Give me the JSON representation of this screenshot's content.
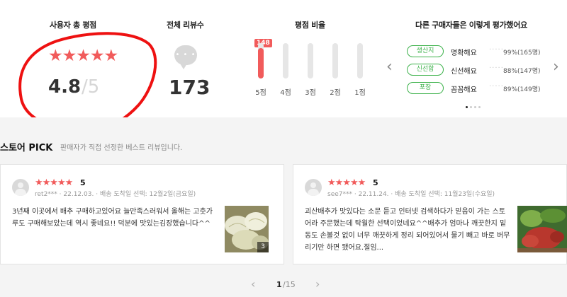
{
  "summary": {
    "rating_title": "사용자 총 평점",
    "stars": "★★★★★",
    "score": "4.8",
    "score_max": "/5",
    "reviews_title": "전체 리뷰수",
    "review_count": "173",
    "ratio_title": "평점 비율",
    "top_count": "148",
    "bars": [
      {
        "label": "5점",
        "fraction": 0.86
      },
      {
        "label": "4점",
        "fraction": 0.0
      },
      {
        "label": "3점",
        "fraction": 0.0
      },
      {
        "label": "2점",
        "fraction": 0.0
      },
      {
        "label": "1점",
        "fraction": 0.0
      }
    ],
    "buyers_title": "다른 구매자들은 이렇게 평가했어요",
    "buyers": [
      {
        "tag": "생산지",
        "desc": "명확해요",
        "pct": "99%",
        "count": "(165명)"
      },
      {
        "tag": "신선함",
        "desc": "신선해요",
        "pct": "88%",
        "count": "(147명)"
      },
      {
        "tag": "포장",
        "desc": "꼼꼼해요",
        "pct": "89%",
        "count": "(149명)"
      }
    ],
    "accent": "#f15b5b",
    "tag_color": "#3db24b"
  },
  "pick": {
    "title": "스토어 PICK",
    "subtitle": "판매자가 직접 선정한 베스트 리뷰입니다."
  },
  "reviews": [
    {
      "stars": "★★★★★",
      "score": "5",
      "user": "ret2***",
      "date": "22.12.03.",
      "option": "배송 도착일 선택: 12월2일(금요일)",
      "text": "3년째 이곳에서 배추 구매하고있어요 늘만족스러워서 올해는 고춧가루도 구매해보았는데 역시 좋네요!! 덕분에 맛있는김장했습니다^^",
      "photo_count": "3"
    },
    {
      "stars": "★★★★★",
      "score": "5",
      "user": "see7***",
      "date": "22.11.24.",
      "option": "배송 도착일 선택: 11월23일(수요일)",
      "text": "괴산배추가 맛있다는 소문 듣고 인터넷 검색하다가 믿음이 가는 스토어라 주문했는데 탁월한 선택이었네요^^배추가 엄마나 깨끗한지 밑동도 손볼것 없이 너무 깨끗하게 정리 되어있어서 물기 빼고 바로 버무리기만 하면 됐어요.절임..."
    }
  ],
  "pagination": {
    "current": "1",
    "total": "/15"
  }
}
